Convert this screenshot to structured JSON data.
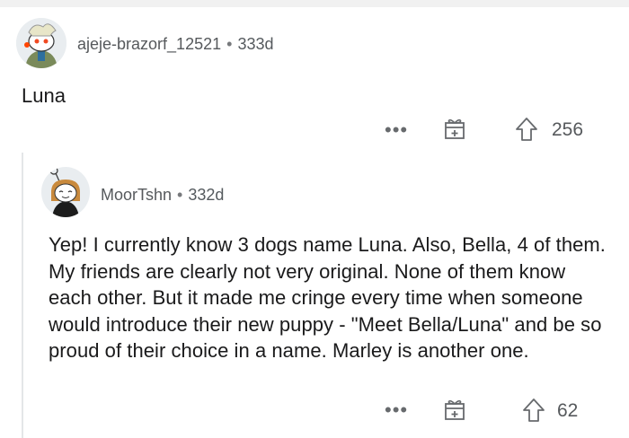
{
  "comment1": {
    "username": "ajeje-brazorf_12521",
    "separator": "•",
    "age": "333d",
    "body": "Luna",
    "actions": {
      "more": "•••",
      "vote_count": "256"
    },
    "avatar_icon": "snoo-avatar-icon"
  },
  "comment2": {
    "username": "MoorTshn",
    "separator": "•",
    "age": "332d",
    "body": "Yep! I currently know 3 dogs name Luna. Also, Bella, 4 of them. My friends are clearly not very original. None of them know each other. But it made me cringe every time when someone would introduce their new puppy - \"Meet Bella/Luna\" and be so proud of their choice in a name. Marley is another one.",
    "actions": {
      "more": "•••",
      "vote_count": "62"
    },
    "avatar_icon": "snoo-avatar-icon"
  },
  "colors": {
    "text": "#1a1a1b",
    "meta": "#56595c",
    "icon": "#676a6d",
    "thread_line": "#e4e6e8"
  }
}
